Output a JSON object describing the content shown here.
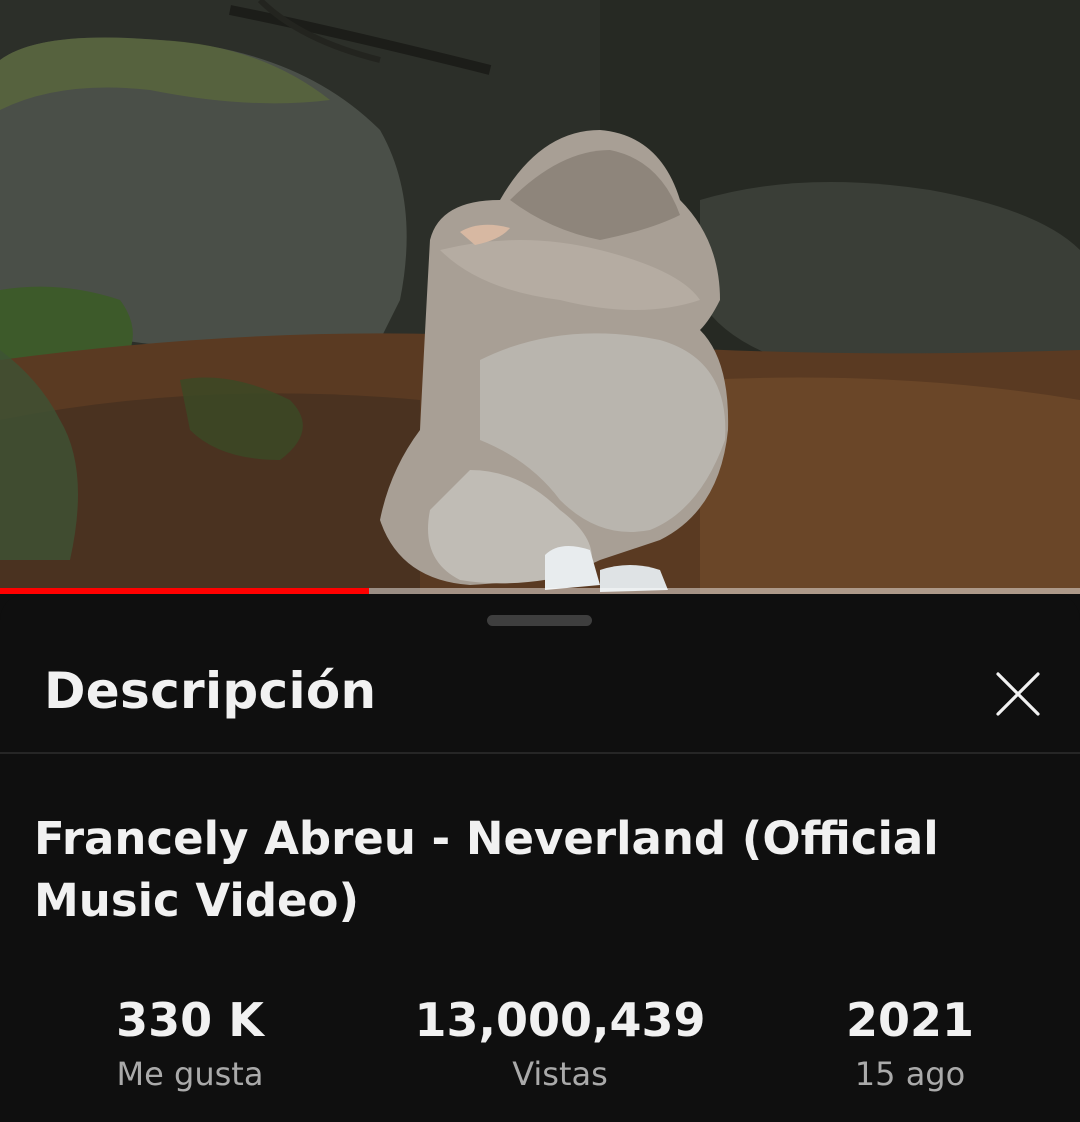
{
  "video": {
    "progress_fraction": 0.342
  },
  "description_panel": {
    "title": "Descripción",
    "close_icon": "close-icon",
    "video_title": "Francely Abreu - Neverland (Official Music Video)",
    "stats": {
      "likes": {
        "value": "330 K",
        "label": "Me gusta"
      },
      "views": {
        "value": "13,000,439",
        "label": "Vistas"
      },
      "date": {
        "value": "2021",
        "label": "15 ago"
      }
    }
  },
  "colors": {
    "progress_played": "#ff0000",
    "sheet_background": "#0f0f0f",
    "primary_text": "#f1f1f1",
    "secondary_text": "#aaaaaa"
  }
}
